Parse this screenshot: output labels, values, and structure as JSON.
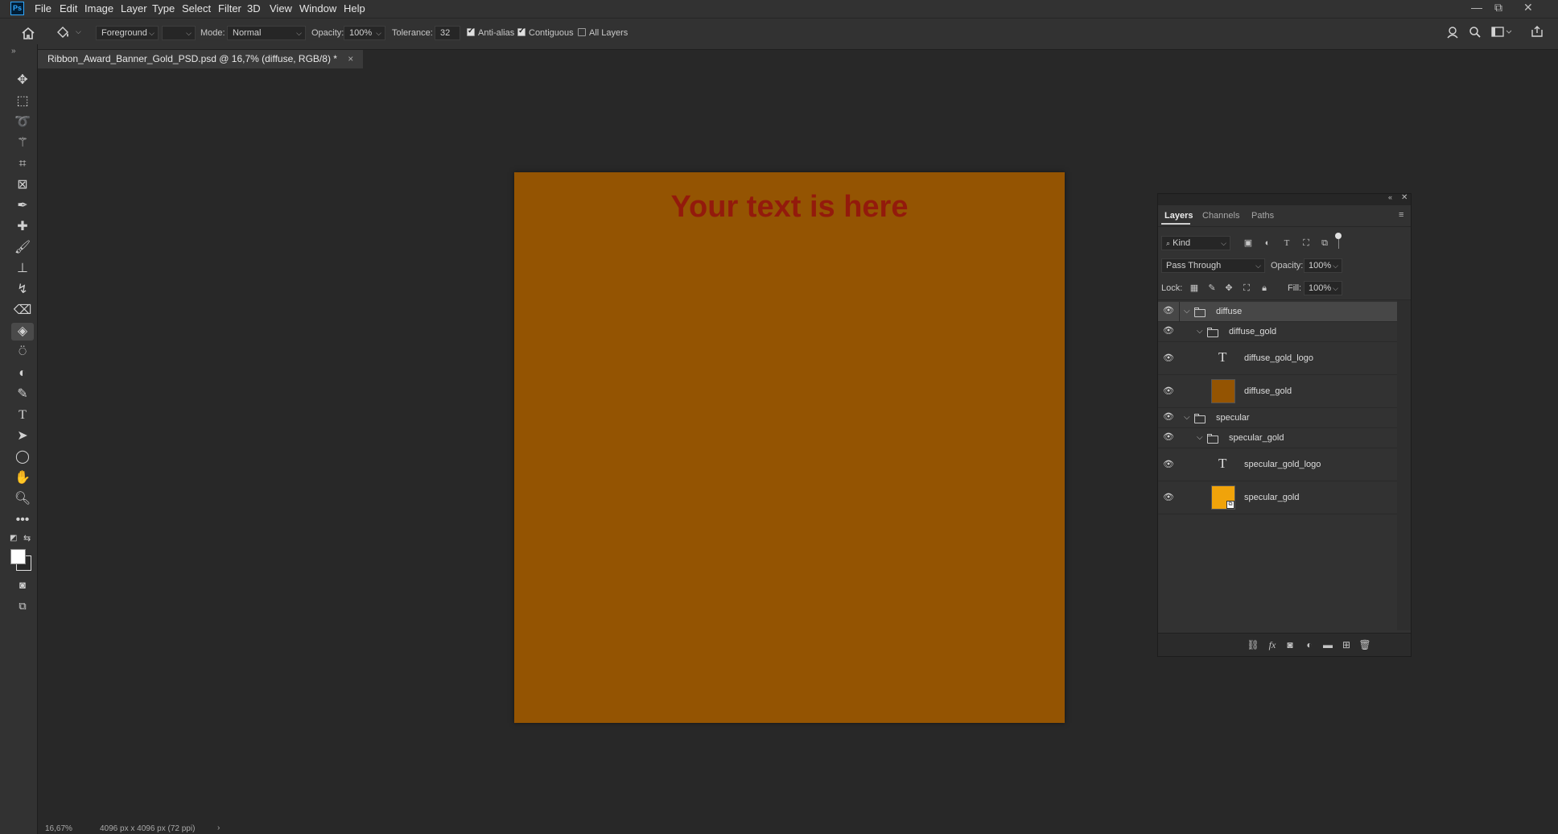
{
  "app": {
    "logo": "Ps"
  },
  "menu": [
    "File",
    "Edit",
    "Image",
    "Layer",
    "Type",
    "Select",
    "Filter",
    "3D",
    "View",
    "Window",
    "Help"
  ],
  "window_controls": {
    "minimize": "—",
    "restore": "⧉",
    "close": "✕"
  },
  "options_bar": {
    "home_icon": "home-icon",
    "tool_icon": "paint-bucket-icon",
    "fill_source": "Foreground",
    "mode_label": "Mode:",
    "mode_value": "Normal",
    "opacity_label": "Opacity:",
    "opacity_value": "100%",
    "tolerance_label": "Tolerance:",
    "tolerance_value": "32",
    "anti_alias_label": "Anti-alias",
    "anti_alias_checked": true,
    "contiguous_label": "Contiguous",
    "contiguous_checked": true,
    "all_layers_label": "All Layers",
    "all_layers_checked": false
  },
  "document_tab": {
    "title": "Ribbon_Award_Banner_Gold_PSD.psd @ 16,7% (diffuse, RGB/8) *",
    "close": "×"
  },
  "canvas": {
    "text": "Your text is here",
    "background": "#945402",
    "text_color": "#931a0c"
  },
  "status": {
    "zoom": "16,67%",
    "doc_info": "4096 px x 4096 px (72 ppi)",
    "arrow": "›"
  },
  "layers_panel": {
    "tabs": [
      "Layers",
      "Channels",
      "Paths"
    ],
    "active_tab": "Layers",
    "filter_kind": "Kind",
    "blend_mode": "Pass Through",
    "opacity_label": "Opacity:",
    "opacity_value": "100%",
    "lock_label": "Lock:",
    "fill_label": "Fill:",
    "fill_value": "100%",
    "layers": [
      {
        "name": "diffuse",
        "type": "group",
        "selected": true
      },
      {
        "name": "diffuse_gold",
        "type": "group"
      },
      {
        "name": "diffuse_gold_logo",
        "type": "text"
      },
      {
        "name": "diffuse_gold",
        "type": "fill",
        "color": "#945402"
      },
      {
        "name": "specular",
        "type": "group"
      },
      {
        "name": "specular_gold",
        "type": "group"
      },
      {
        "name": "specular_gold_logo",
        "type": "text"
      },
      {
        "name": "specular_gold",
        "type": "smart",
        "color": "#f0a30a"
      }
    ]
  }
}
